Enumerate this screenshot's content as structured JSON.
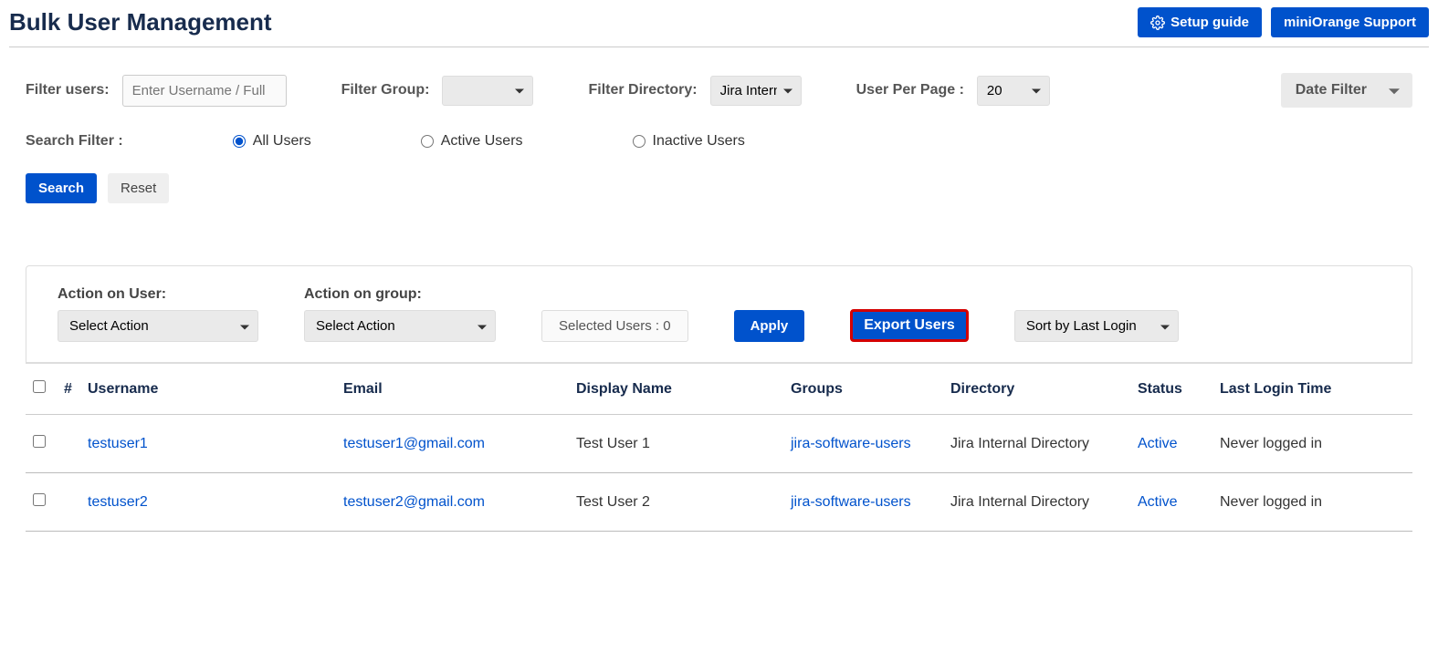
{
  "header": {
    "title": "Bulk User Management",
    "setup_guide": "Setup guide",
    "support": "miniOrange Support"
  },
  "filters": {
    "users_label": "Filter users:",
    "users_placeholder": "Enter Username / Full",
    "group_label": "Filter Group:",
    "group_value": "",
    "directory_label": "Filter Directory:",
    "directory_value": "Jira Internal",
    "per_page_label": "User Per Page :",
    "per_page_value": "20",
    "date_filter_label": "Date Filter"
  },
  "search_filter": {
    "label": "Search Filter :",
    "options": [
      "All Users",
      "Active Users",
      "Inactive Users"
    ],
    "selected": "All Users"
  },
  "buttons": {
    "search": "Search",
    "reset": "Reset",
    "apply": "Apply",
    "export": "Export Users"
  },
  "actions": {
    "user_label": "Action on User:",
    "user_value": "Select Action",
    "group_label": "Action on group:",
    "group_value": "Select Action",
    "selected_users_label": "Selected Users : 0",
    "sort_value": "Sort by Last Login"
  },
  "table": {
    "headers": {
      "num": "#",
      "username": "Username",
      "email": "Email",
      "display": "Display Name",
      "groups": "Groups",
      "directory": "Directory",
      "status": "Status",
      "last_login": "Last Login Time"
    },
    "rows": [
      {
        "username": "testuser1",
        "email": "testuser1@gmail.com",
        "display": "Test User 1",
        "groups": "jira-software-users",
        "directory": "Jira Internal Directory",
        "status": "Active",
        "last_login": "Never logged in"
      },
      {
        "username": "testuser2",
        "email": "testuser2@gmail.com",
        "display": "Test User 2",
        "groups": "jira-software-users",
        "directory": "Jira Internal Directory",
        "status": "Active",
        "last_login": "Never logged in"
      }
    ]
  }
}
